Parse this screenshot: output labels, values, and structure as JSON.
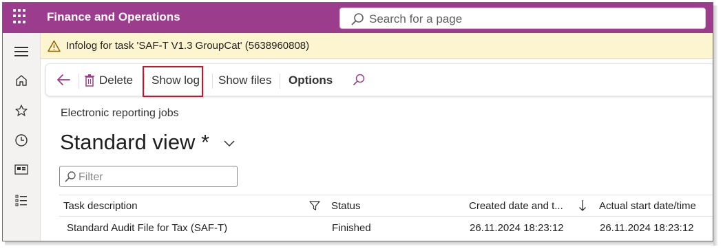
{
  "app": {
    "title": "Finance and Operations",
    "brand_color": "#9b3c8c"
  },
  "search": {
    "placeholder": "Search for a page"
  },
  "infobar": {
    "text": "Infolog for task 'SAF-T V1.3 GroupCat' (5638960808)"
  },
  "actions": {
    "back_icon": "back-arrow-icon",
    "delete_label": "Delete",
    "show_log_label": "Show log",
    "show_files_label": "Show files",
    "options_label": "Options",
    "search_icon": "search-icon"
  },
  "nav": [
    "hamburger-icon",
    "home-icon",
    "star-icon",
    "clock-icon",
    "workspace-icon",
    "list-icon"
  ],
  "page": {
    "caption": "Electronic reporting jobs",
    "view_title": "Standard view *",
    "filter_placeholder": "Filter"
  },
  "grid": {
    "headers": {
      "task_description": "Task description",
      "status": "Status",
      "created": "Created date and t...",
      "actual_start": "Actual start date/time"
    },
    "rows": [
      {
        "task_description": "Standard Audit File for Tax (SAF-T)",
        "status": "Finished",
        "created": "26.11.2024 18:23:12",
        "actual_start": "26.11.2024 18:23:12"
      }
    ]
  }
}
